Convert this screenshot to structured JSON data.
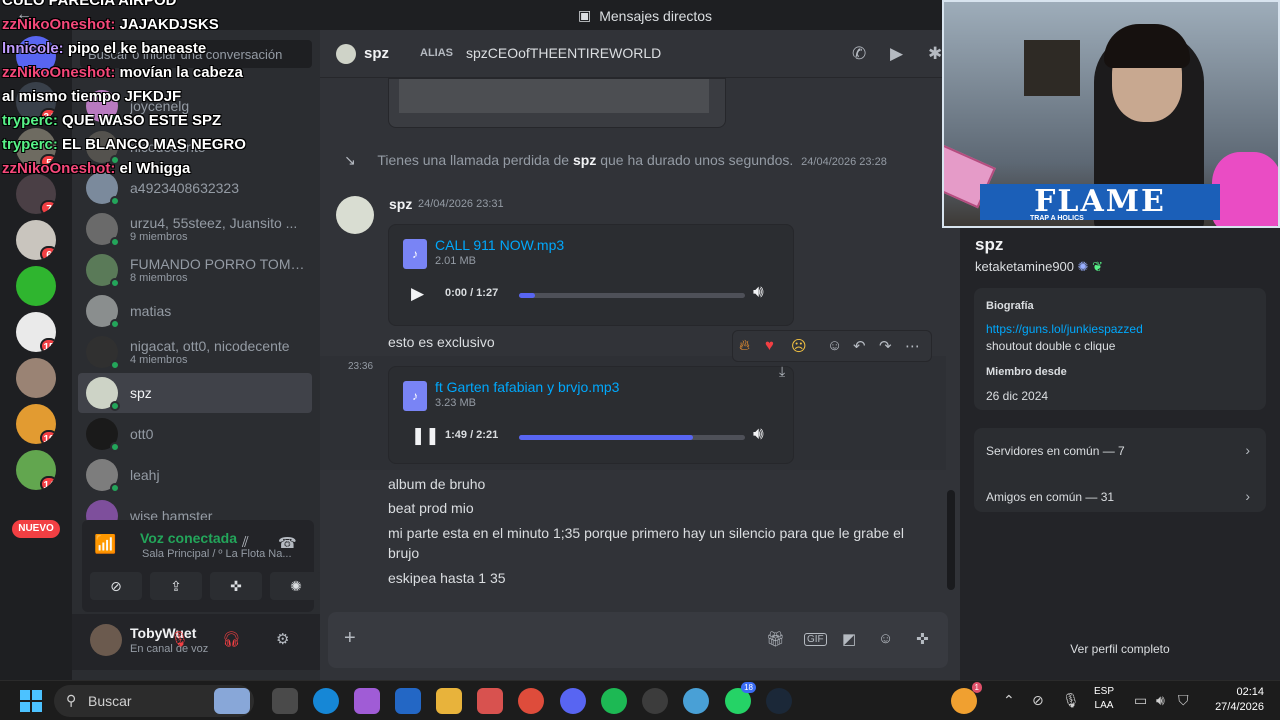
{
  "window": {
    "title": "Mensajes directos"
  },
  "sidebar": {
    "search_placeholder": "Buscar o iniciar una conversación",
    "dms": [
      {
        "name": "joycenelg",
        "sub": "",
        "color": "#b97ac0"
      },
      {
        "name": "nicodecente",
        "sub": "",
        "color": "#54524e"
      },
      {
        "name": "a4923408632323",
        "sub": "",
        "color": "#7b8a9c"
      },
      {
        "name": "urzu4, 55steez, Juansito ...",
        "sub": "9 miembros",
        "color": "#6a6a6a"
      },
      {
        "name": "FUMANDO PORRO TOMA...",
        "sub": "8 miembros",
        "color": "#5a7a58"
      },
      {
        "name": "matias",
        "sub": "",
        "color": "#8a8e8e"
      },
      {
        "name": "nigacat, ott0, nicodecente",
        "sub": "4 miembros",
        "color": "#303030"
      },
      {
        "name": "spz",
        "sub": "",
        "color": "#cdd3c6"
      },
      {
        "name": "ott0",
        "sub": "",
        "color": "#1a1a1a"
      },
      {
        "name": "leahj",
        "sub": "",
        "color": "#7d7d7d"
      },
      {
        "name": "wise hamster",
        "sub": "",
        "color": "#7e4f9c"
      }
    ]
  },
  "rail": {
    "servers": [
      {
        "color": "#5865f2",
        "badge": ""
      },
      {
        "color": "#39404a",
        "badge": "34"
      },
      {
        "color": "#6e6b61",
        "badge": "5"
      },
      {
        "color": "#4a3f45",
        "badge": "7"
      },
      {
        "color": "#c9c5be",
        "badge": "6"
      },
      {
        "color": "#2fb52f",
        "badge": ""
      },
      {
        "color": "#eaeaea",
        "badge": "15"
      },
      {
        "color": "#9a8374",
        "badge": ""
      },
      {
        "color": "#e29b31",
        "badge": "19"
      },
      {
        "color": "#62a64f",
        "badge": "14"
      }
    ],
    "new_label": "NUEVO"
  },
  "voice": {
    "title": "Voz conectada",
    "channel": "Sala Principal / º La Flota Na..."
  },
  "user": {
    "name": "TobyWuet",
    "status": "En canal de voz"
  },
  "chat": {
    "header": {
      "name": "spz",
      "alias_label": "ALIAS",
      "alias": "spzCEOofTHEENTIREWORLD"
    },
    "missed_call": {
      "prefix": "Tienes una llamada perdida de",
      "name": "spz",
      "suffix": "que ha durado unos segundos.",
      "time": "24/04/2026 23:28"
    },
    "author": "spz",
    "timestamp": "24/04/2026 23:31",
    "audio1": {
      "name": "CALL 911 NOW.mp3",
      "size": "2.01 MB",
      "time": "0:00 / 1:27",
      "progress": 0.07
    },
    "msg1": "esto es exclusivo",
    "hover_time": "23:36",
    "audio2": {
      "name": "ft Garten fafabian y brvjo.mp3",
      "size": "3.23 MB",
      "time": "1:49 / 2:21",
      "progress": 0.77
    },
    "lines": [
      "album de bruho",
      "beat prod mio",
      "mi parte esta en el minuto 1;35 porque primero hay un silencio para que le grabe el brujo",
      "eskipea hasta 1 35"
    ]
  },
  "profile": {
    "name": "spz",
    "username": "ketaketamine900",
    "bio_label": "Biografía",
    "bio_link": "https://guns.lol/junkiespazzed",
    "bio_text": "shoutout double c clique",
    "member_label": "Miembro desde",
    "member_date": "26 dic 2024",
    "servers": "Servidores en común — 7",
    "friends": "Amigos en común — 31",
    "footer": "Ver perfil completo"
  },
  "cam": {
    "logo": "FLAME",
    "logo_sub": "TRAP A HOLICS"
  },
  "overlay": [
    {
      "user": "",
      "text": "CULO PARECIA AIRPOD",
      "cls": ""
    },
    {
      "user": "zzNikoOneshot:",
      "text": " JAJAKDJSKS",
      "cls": "u1"
    },
    {
      "user": "lnnicole:",
      "text": " pipo el ke baneaste",
      "cls": "u3"
    },
    {
      "user": "zzNikoOneshot:",
      "text": " movían la cabeza",
      "cls": "u1"
    },
    {
      "user": "",
      "text": "al mismo tiempo JFKDJF",
      "cls": ""
    },
    {
      "user": "tryperc:",
      "text": " QUE WASO ESTE SPZ",
      "cls": "u2"
    },
    {
      "user": "tryperc:",
      "text": " EL BLANCO MAS NEGRO",
      "cls": "u2"
    },
    {
      "user": "zzNikoOneshot:",
      "text": " el Whigga",
      "cls": "u1"
    }
  ],
  "taskbar": {
    "search": "Buscar",
    "lang": "ESP",
    "lang2": "LAA",
    "time": "02:14",
    "date": "27/4/2026",
    "badge1": "18",
    "badge2": "1"
  }
}
